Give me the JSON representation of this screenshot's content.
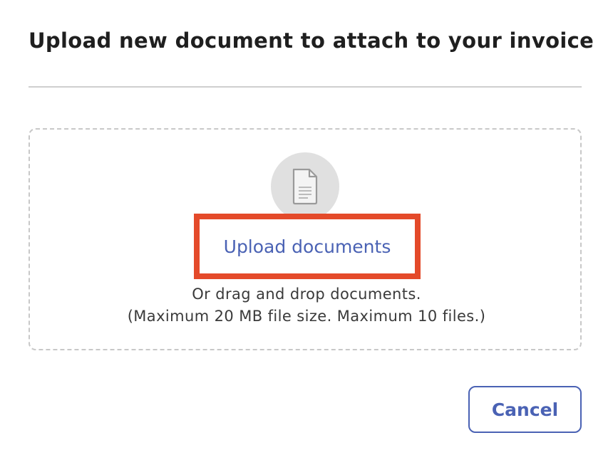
{
  "dialog": {
    "title": "Upload new document to attach to your invoice"
  },
  "dropzone": {
    "icon": "document-icon",
    "upload_link_label": "Upload documents",
    "drag_text": "Or drag and drop documents.",
    "limits_text": "(Maximum 20 MB file size. Maximum 10 files.)"
  },
  "actions": {
    "cancel_label": "Cancel"
  },
  "colors": {
    "accent": "#4a62b4",
    "highlight_border": "#e44a2a",
    "dropzone_border": "#c8c8c8",
    "icon_circle": "#e0e0e0"
  }
}
